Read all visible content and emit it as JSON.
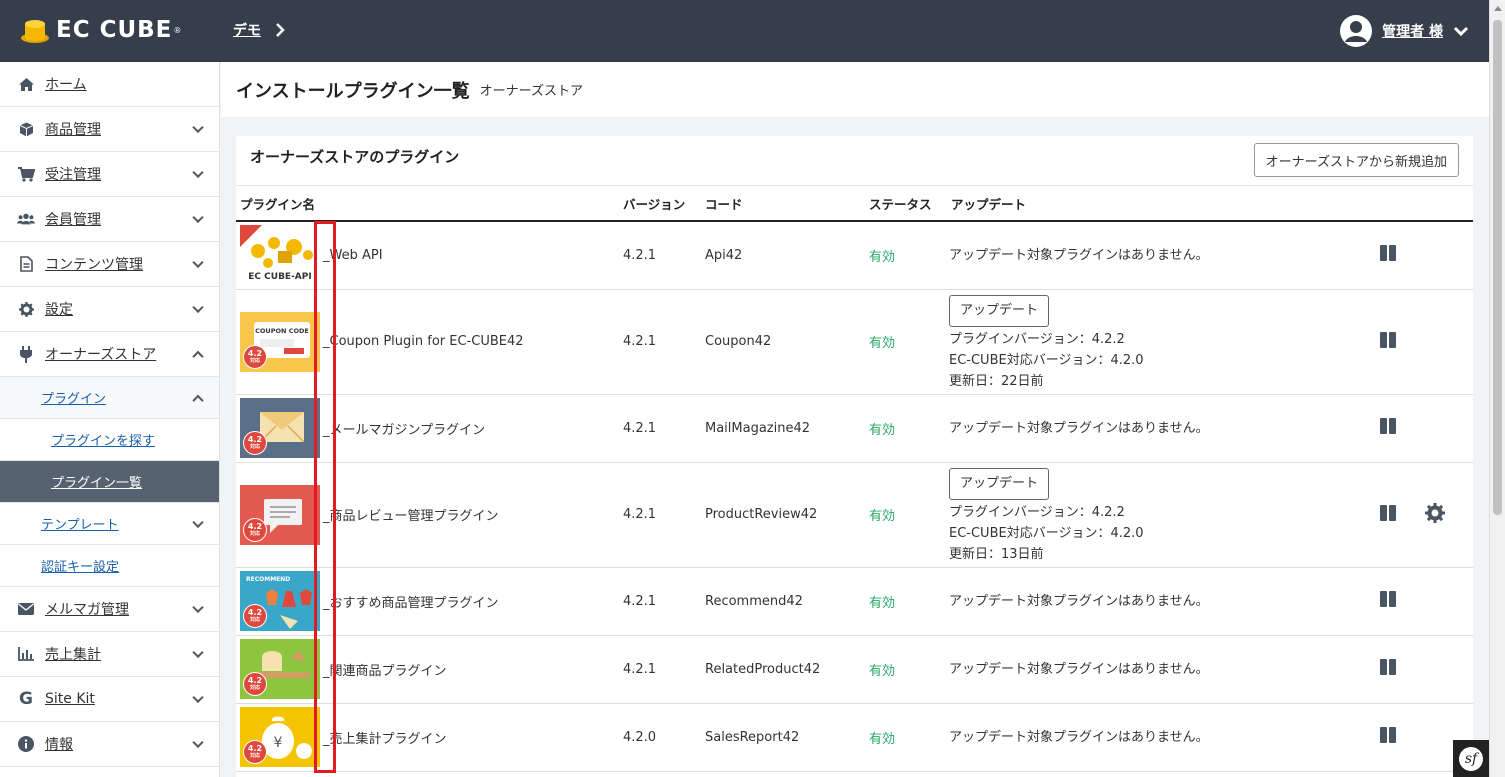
{
  "header": {
    "logo_text": "EC CUBE",
    "logo_reg": "®",
    "shop_name": "デモ",
    "user_name": "管理者 様"
  },
  "sidebar": {
    "items": [
      {
        "label": "ホーム",
        "icon": "home-icon"
      },
      {
        "label": "商品管理",
        "icon": "cube-icon"
      },
      {
        "label": "受注管理",
        "icon": "cart-icon"
      },
      {
        "label": "会員管理",
        "icon": "users-icon"
      },
      {
        "label": "コンテンツ管理",
        "icon": "file-icon"
      },
      {
        "label": "設定",
        "icon": "gear-icon"
      },
      {
        "label": "オーナーズストア",
        "icon": "plug-icon"
      }
    ],
    "store_sub": {
      "plugin": "プラグイン",
      "find_plugin": "プラグインを探す",
      "plugin_list": "プラグイン一覧",
      "template": "テンプレート",
      "auth_key": "認証キー設定"
    },
    "items_after": [
      {
        "label": "メルマガ管理",
        "icon": "envelope-icon"
      },
      {
        "label": "売上集計",
        "icon": "bar-chart-icon"
      },
      {
        "label": "Site Kit",
        "icon": "google-icon"
      },
      {
        "label": "情報",
        "icon": "info-icon"
      }
    ]
  },
  "page": {
    "title": "インストールプラグイン一覧",
    "subtitle": "オーナーズストア"
  },
  "card": {
    "title": "オーナーズストアのプラグイン",
    "add_button": "オーナーズストアから新規追加",
    "columns": [
      "プラグイン名",
      "バージョン",
      "コード",
      "ステータス",
      "アップデート"
    ],
    "update_button": "アップデート",
    "rows": [
      {
        "name": "_Web API",
        "version": "4.2.1",
        "code": "Api42",
        "status": "有効",
        "update": "アップデート対象プラグインはありません。",
        "thumb_text": "EC CUBE-API",
        "thumb_bg": "#ffffff"
      },
      {
        "name": "_Coupon Plugin for EC-CUBE42",
        "version": "4.2.1",
        "code": "Coupon42",
        "status": "有効",
        "update_available": true,
        "plugin_version": "プラグインバージョン：4.2.2",
        "eccube_version": "EC-CUBE対応バージョン：4.2.0",
        "updated": "更新日：22日前",
        "thumb_text": "COUPON CODE",
        "thumb_bg": "#f7c64a"
      },
      {
        "name": "_メールマガジンプラグイン",
        "version": "4.2.1",
        "code": "MailMagazine42",
        "status": "有効",
        "update": "アップデート対象プラグインはありません。",
        "thumb_bg": "#5a7088"
      },
      {
        "name": "_商品レビュー管理プラグイン",
        "version": "4.2.1",
        "code": "ProductReview42",
        "status": "有効",
        "update_available": true,
        "plugin_version": "プラグインバージョン：4.2.2",
        "eccube_version": "EC-CUBE対応バージョン：4.2.0",
        "updated": "更新日：13日前",
        "thumb_bg": "#e25a50",
        "has_settings": true
      },
      {
        "name": "_おすすめ商品管理プラグイン",
        "version": "4.2.1",
        "code": "Recommend42",
        "status": "有効",
        "update": "アップデート対象プラグインはありません。",
        "thumb_text": "RECOMMEND",
        "thumb_bg": "#3aa7c9"
      },
      {
        "name": "_関連商品プラグイン",
        "version": "4.2.1",
        "code": "RelatedProduct42",
        "status": "有効",
        "update": "アップデート対象プラグインはありません。",
        "thumb_bg": "#8cc63f"
      },
      {
        "name": "_売上集計プラグイン",
        "version": "4.2.0",
        "code": "SalesReport42",
        "status": "有効",
        "update": "アップデート対象プラグインはありません。",
        "thumb_bg": "#f5c400"
      }
    ],
    "badge_main": "4.2",
    "badge_sub": "対応"
  },
  "colors": {
    "header_bg": "#353e4a",
    "active_nav": "#56626f",
    "status_green": "#2aa86a",
    "highlight_red": "#e21b23"
  }
}
